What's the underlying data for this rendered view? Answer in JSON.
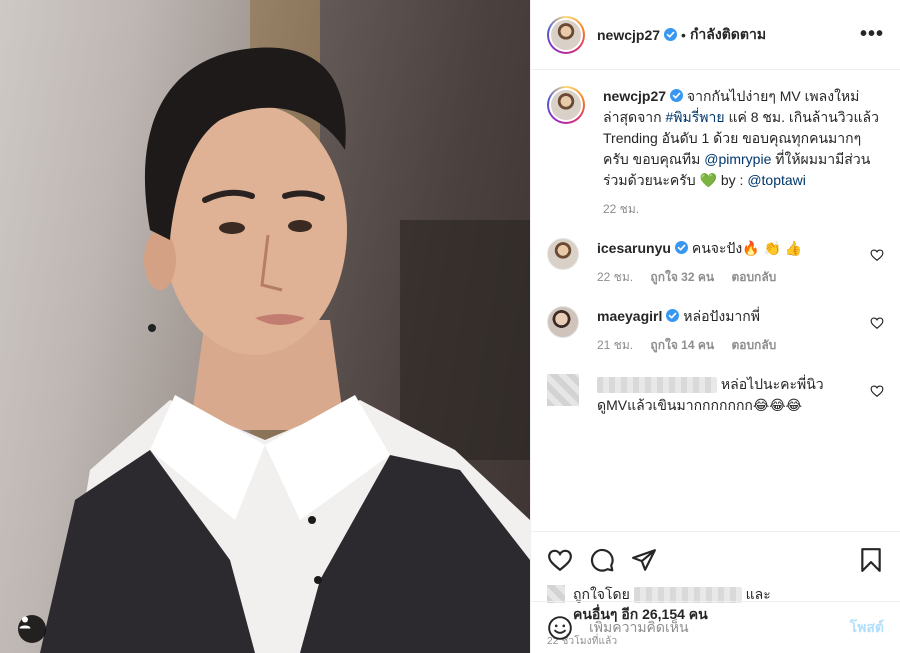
{
  "header": {
    "username": "newcjp27",
    "separator": "•",
    "follow_label": "กำลังติดตาม",
    "more_label": "•••"
  },
  "caption": {
    "username": "newcjp27",
    "text_1": "จากกันไปง่ายๆ MV เพลงใหม่ล่าสุดจาก ",
    "hashtag": "#พิมรี่พาย",
    "text_2": " แค่ 8 ชม. เกินล้านวิวแล้ว Trending อันดับ 1 ด้วย ขอบคุณทุกคนมากๆ ครับ ขอบคุณทีม ",
    "mention_1": "@pimrypie",
    "text_3": " ที่ให้ผมมามีส่วนร่วมด้วยนะครับ ",
    "emoji": "💚",
    "text_4": " by : ",
    "mention_2": "@toptawi",
    "time": "22 ชม."
  },
  "comments": [
    {
      "username": "icesarunyu",
      "text": "คนจะปัง🔥 👏 👍",
      "time": "22 ชม.",
      "likes": "ถูกใจ 32 คน",
      "reply": "ตอบกลับ"
    },
    {
      "username": "maeyagirl",
      "text": "หล่อปังมากพี่",
      "time": "21 ชม.",
      "likes": "ถูกใจ 14 คน",
      "reply": "ตอบกลับ"
    },
    {
      "username": "",
      "text": "หล่อไปนะคะพี่นิว ดูMVแล้วเขินมากกกกกกก😂😂😂"
    }
  ],
  "likes": {
    "liked_by": "ถูกใจโดย",
    "and": "และ",
    "others": "คนอื่นๆ อีก 26,154 คน"
  },
  "timestamp": "22 ชั่วโมงที่แล้ว",
  "add_comment": {
    "placeholder": "เพิ่มความคิดเห็น",
    "post_label": "โพสต์"
  },
  "colors": {
    "verified": "#3897f0",
    "link": "#00376b",
    "post_disabled": "#b2dffc",
    "muted": "#8e8e8e"
  },
  "icons": [
    "heart-icon",
    "comment-icon",
    "share-icon",
    "bookmark-icon",
    "smile-icon",
    "user-tag-icon",
    "verified-badge-icon"
  ]
}
